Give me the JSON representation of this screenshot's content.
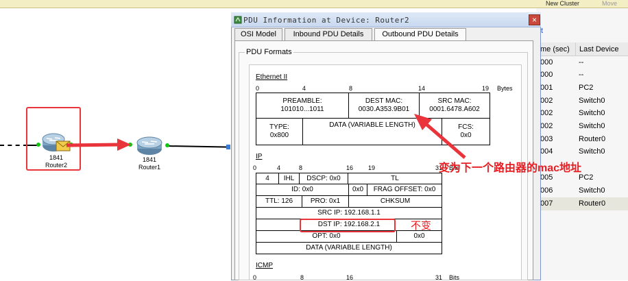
{
  "topbar": {
    "new_cluster": "New Cluster",
    "move": "Move"
  },
  "devices": [
    {
      "model": "1841",
      "name": "Router2"
    },
    {
      "model": "1841",
      "name": "Router1"
    }
  ],
  "dialog": {
    "title": "PDU Information at Device: Router2",
    "close": "×",
    "tabs": [
      "OSI Model",
      "Inbound PDU Details",
      "Outbound PDU Details"
    ],
    "active_tab": "Outbound PDU Details",
    "group_label": "PDU Formats",
    "ethernet": {
      "title": "Ethernet II",
      "ruler": [
        "0",
        "4",
        "8",
        "14",
        "19",
        "Bytes"
      ],
      "preamble_label": "PREAMBLE:",
      "preamble_value": "101010...1011",
      "dest_label": "DEST MAC:",
      "dest_value": "0030.A353.9B01",
      "src_label": "SRC MAC:",
      "src_value": "0001.6478.A602",
      "type_label": "TYPE:",
      "type_value": "0x800",
      "data": "DATA (VARIABLE LENGTH)",
      "fcs_label": "FCS:",
      "fcs_value": "0x0"
    },
    "ip": {
      "title": "IP",
      "ruler": [
        "0",
        "4",
        "8",
        "16",
        "19",
        "31",
        "Bits"
      ],
      "ver": "4",
      "ihl": "IHL",
      "dscp": "DSCP: 0x0",
      "tl": "TL",
      "id": "ID: 0x0",
      "flags": "0x0",
      "frag": "FRAG OFFSET: 0x0",
      "ttl": "TTL: 126",
      "pro": "PRO: 0x1",
      "chksum": "CHKSUM",
      "src": "SRC IP: 192.168.1.1",
      "dst": "DST IP: 192.168.2.1",
      "opt": "OPT: 0x0",
      "opt_pad": "0x0",
      "data": "DATA (VARIABLE LENGTH)"
    },
    "icmp": {
      "title": "ICMP",
      "ruler": [
        "0",
        "8",
        "16",
        "31",
        "Bits"
      ]
    }
  },
  "right_panel": {
    "link_text": "t",
    "headers": [
      "me (sec)",
      "Last Device"
    ],
    "rows": [
      [
        "000",
        "--"
      ],
      [
        "000",
        "--"
      ],
      [
        "001",
        "PC2"
      ],
      [
        "002",
        "Switch0"
      ],
      [
        "002",
        "Switch0"
      ],
      [
        "002",
        "Switch0"
      ],
      [
        "003",
        "Router0"
      ],
      [
        "004",
        "Switch0"
      ],
      [
        "005",
        "PC2"
      ],
      [
        "006",
        "Switch0"
      ],
      [
        "007",
        "Router0"
      ]
    ]
  },
  "annotations": {
    "mac_note": "变为下一个路由器的mac地址",
    "ip_note": "不变"
  },
  "colors": {
    "annotation": "#e8343a",
    "link_light": "#11c611",
    "dialog_border": "#7a96c8"
  }
}
